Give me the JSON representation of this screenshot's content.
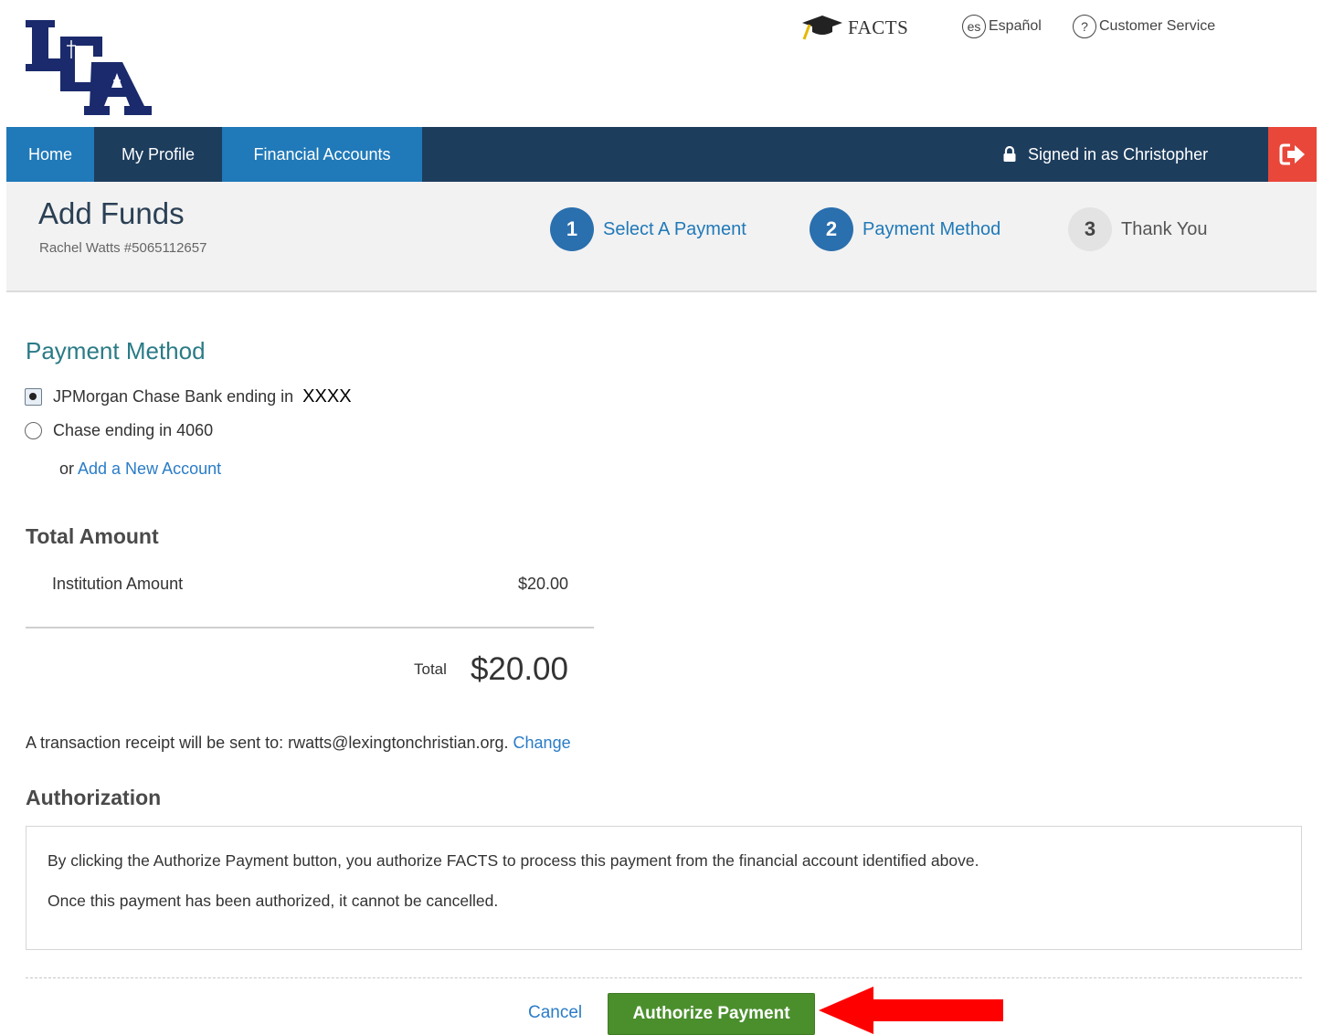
{
  "header": {
    "logo_text": "LCA",
    "facts_label": "FACTS",
    "lang_icon": "es",
    "lang_label": "Español",
    "cs_icon": "?",
    "cs_label": "Customer Service"
  },
  "nav": {
    "items": [
      {
        "label": "Home",
        "active": true
      },
      {
        "label": "My Profile",
        "active": false
      },
      {
        "label": "Financial Accounts",
        "active": true
      }
    ],
    "signed_in": "Signed in as Christopher"
  },
  "page": {
    "title": "Add Funds",
    "subtitle": "Rachel Watts #5065112657"
  },
  "steps": [
    {
      "num": "1",
      "label": "Select A Payment",
      "state": "active"
    },
    {
      "num": "2",
      "label": "Payment Method",
      "state": "active"
    },
    {
      "num": "3",
      "label": "Thank You",
      "state": "inactive"
    }
  ],
  "payment_method": {
    "heading": "Payment Method",
    "options": [
      {
        "label": "JPMorgan Chase Bank ending in",
        "masked": "XXXX",
        "selected": true
      },
      {
        "label": "Chase ending in 4060",
        "masked": "",
        "selected": false
      }
    ],
    "or_text": "or ",
    "add_account": "Add a New Account"
  },
  "total_amount": {
    "heading": "Total Amount",
    "line_label": "Institution Amount",
    "line_value": "$20.00",
    "total_label": "Total",
    "total_value": "$20.00"
  },
  "receipt": {
    "text": "A transaction receipt will be sent to: rwatts@lexingtonchristian.org. ",
    "change": "Change"
  },
  "authorization": {
    "heading": "Authorization",
    "line1": "By clicking the Authorize Payment button, you authorize FACTS to process this payment from the financial account identified above.",
    "line2": "Once this payment has been authorized, it cannot be cancelled."
  },
  "actions": {
    "cancel": "Cancel",
    "authorize": "Authorize Payment"
  },
  "colors": {
    "nav_dark": "#1d3d5d",
    "nav_blue": "#2079b8",
    "logout_red": "#e8473a",
    "step_active": "#2a6fae",
    "section_teal": "#2a7b86",
    "link_blue": "#2a7cc7",
    "button_green": "#4b8f2d",
    "arrow_red": "#ff0000",
    "logo_navy": "#1a2a6c"
  }
}
